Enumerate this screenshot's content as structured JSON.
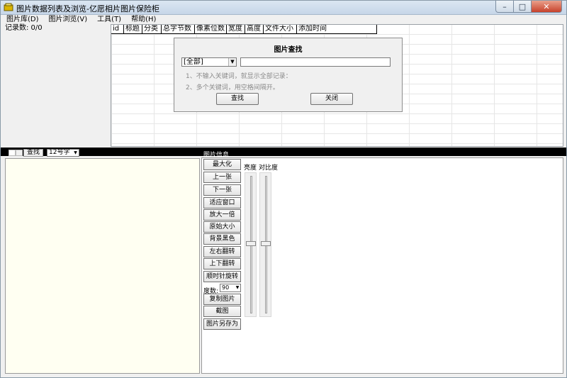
{
  "window": {
    "title": "图片数据列表及浏览-亿愿相片图片保险柜"
  },
  "menu": [
    "图片库(D)",
    "图片浏览(V)",
    "工具(T)",
    "帮助(H)"
  ],
  "left_panel": {
    "record_count": "记录数: 0/0"
  },
  "grid": {
    "columns": [
      "id",
      "标题",
      "分类",
      "总字节数",
      "像素位数",
      "宽度",
      "高度",
      "文件大小",
      "添加时间"
    ]
  },
  "search_dialog": {
    "title": "图片查找",
    "category_value": "[全部]",
    "hint1": "1、不输入关键词，就显示全部记录：",
    "hint2": "2、多个关键词，用空格间隔开。",
    "find_label": "查找",
    "close_label": "关闭"
  },
  "toolbar": {
    "find_label": "查找",
    "font_size_value": "12号字",
    "info_label": "图片信息"
  },
  "commands": [
    "最大化",
    "上一张",
    "下一张",
    "适应窗口",
    "放大一倍",
    "原始大小",
    "背景黑色",
    "左右翻转",
    "上下翻转",
    "顺时针旋转",
    "复制图片",
    "截图",
    "图片另存为"
  ],
  "rotate": {
    "label": "度数:",
    "value": "90"
  },
  "sliders": {
    "brightness_label": "亮度",
    "contrast_label": "对比度"
  },
  "colors": {
    "window_bg": "#f0f0f0",
    "preview_bg": "#fffff2",
    "close_button": "#c7412b"
  }
}
